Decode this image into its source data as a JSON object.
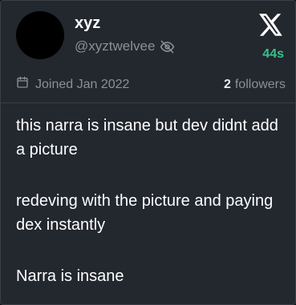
{
  "profile": {
    "display_name": "xyz",
    "handle": "@xyztwelvee",
    "avatar_color": "#000000"
  },
  "header": {
    "time_ago": "44s",
    "time_color": "#35c28a"
  },
  "meta": {
    "joined": "Joined Jan 2022",
    "followers_count": "2",
    "followers_label": "followers"
  },
  "tweet": {
    "paragraphs": [
      "this narra is insane but dev didnt add a picture",
      "redeving with the picture and paying dex instantly",
      "Narra is insane"
    ]
  },
  "icons": [
    "x-logo-icon",
    "hidden-eye-icon",
    "calendar-icon"
  ]
}
